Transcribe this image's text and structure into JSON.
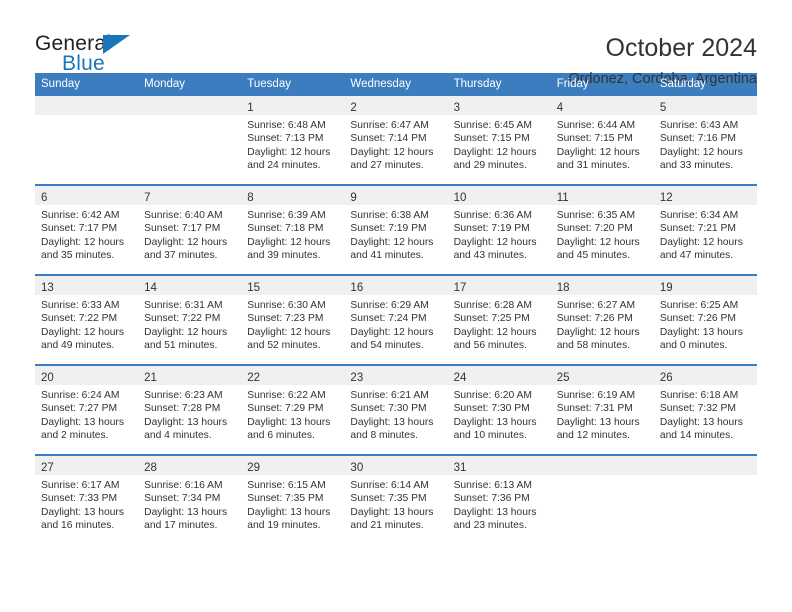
{
  "brand": {
    "name_top": "General",
    "name_bottom": "Blue",
    "accent": "#1b75bb"
  },
  "header": {
    "title": "October 2024",
    "location": "Ordonez, Cordoba, Argentina"
  },
  "theme": {
    "header_blue": "#3b7dbf",
    "daynum_band": "#f0f0f0",
    "text": "#333333"
  },
  "weekdays": [
    "Sunday",
    "Monday",
    "Tuesday",
    "Wednesday",
    "Thursday",
    "Friday",
    "Saturday"
  ],
  "labels": {
    "sunrise": "Sunrise:",
    "sunset": "Sunset:",
    "daylight": "Daylight:"
  },
  "weeks": [
    [
      {
        "day": ""
      },
      {
        "day": ""
      },
      {
        "day": "1",
        "sunrise": "Sunrise: 6:48 AM",
        "sunset": "Sunset: 7:13 PM",
        "daylight1": "Daylight: 12 hours",
        "daylight2": "and 24 minutes."
      },
      {
        "day": "2",
        "sunrise": "Sunrise: 6:47 AM",
        "sunset": "Sunset: 7:14 PM",
        "daylight1": "Daylight: 12 hours",
        "daylight2": "and 27 minutes."
      },
      {
        "day": "3",
        "sunrise": "Sunrise: 6:45 AM",
        "sunset": "Sunset: 7:15 PM",
        "daylight1": "Daylight: 12 hours",
        "daylight2": "and 29 minutes."
      },
      {
        "day": "4",
        "sunrise": "Sunrise: 6:44 AM",
        "sunset": "Sunset: 7:15 PM",
        "daylight1": "Daylight: 12 hours",
        "daylight2": "and 31 minutes."
      },
      {
        "day": "5",
        "sunrise": "Sunrise: 6:43 AM",
        "sunset": "Sunset: 7:16 PM",
        "daylight1": "Daylight: 12 hours",
        "daylight2": "and 33 minutes."
      }
    ],
    [
      {
        "day": "6",
        "sunrise": "Sunrise: 6:42 AM",
        "sunset": "Sunset: 7:17 PM",
        "daylight1": "Daylight: 12 hours",
        "daylight2": "and 35 minutes."
      },
      {
        "day": "7",
        "sunrise": "Sunrise: 6:40 AM",
        "sunset": "Sunset: 7:17 PM",
        "daylight1": "Daylight: 12 hours",
        "daylight2": "and 37 minutes."
      },
      {
        "day": "8",
        "sunrise": "Sunrise: 6:39 AM",
        "sunset": "Sunset: 7:18 PM",
        "daylight1": "Daylight: 12 hours",
        "daylight2": "and 39 minutes."
      },
      {
        "day": "9",
        "sunrise": "Sunrise: 6:38 AM",
        "sunset": "Sunset: 7:19 PM",
        "daylight1": "Daylight: 12 hours",
        "daylight2": "and 41 minutes."
      },
      {
        "day": "10",
        "sunrise": "Sunrise: 6:36 AM",
        "sunset": "Sunset: 7:19 PM",
        "daylight1": "Daylight: 12 hours",
        "daylight2": "and 43 minutes."
      },
      {
        "day": "11",
        "sunrise": "Sunrise: 6:35 AM",
        "sunset": "Sunset: 7:20 PM",
        "daylight1": "Daylight: 12 hours",
        "daylight2": "and 45 minutes."
      },
      {
        "day": "12",
        "sunrise": "Sunrise: 6:34 AM",
        "sunset": "Sunset: 7:21 PM",
        "daylight1": "Daylight: 12 hours",
        "daylight2": "and 47 minutes."
      }
    ],
    [
      {
        "day": "13",
        "sunrise": "Sunrise: 6:33 AM",
        "sunset": "Sunset: 7:22 PM",
        "daylight1": "Daylight: 12 hours",
        "daylight2": "and 49 minutes."
      },
      {
        "day": "14",
        "sunrise": "Sunrise: 6:31 AM",
        "sunset": "Sunset: 7:22 PM",
        "daylight1": "Daylight: 12 hours",
        "daylight2": "and 51 minutes."
      },
      {
        "day": "15",
        "sunrise": "Sunrise: 6:30 AM",
        "sunset": "Sunset: 7:23 PM",
        "daylight1": "Daylight: 12 hours",
        "daylight2": "and 52 minutes."
      },
      {
        "day": "16",
        "sunrise": "Sunrise: 6:29 AM",
        "sunset": "Sunset: 7:24 PM",
        "daylight1": "Daylight: 12 hours",
        "daylight2": "and 54 minutes."
      },
      {
        "day": "17",
        "sunrise": "Sunrise: 6:28 AM",
        "sunset": "Sunset: 7:25 PM",
        "daylight1": "Daylight: 12 hours",
        "daylight2": "and 56 minutes."
      },
      {
        "day": "18",
        "sunrise": "Sunrise: 6:27 AM",
        "sunset": "Sunset: 7:26 PM",
        "daylight1": "Daylight: 12 hours",
        "daylight2": "and 58 minutes."
      },
      {
        "day": "19",
        "sunrise": "Sunrise: 6:25 AM",
        "sunset": "Sunset: 7:26 PM",
        "daylight1": "Daylight: 13 hours",
        "daylight2": "and 0 minutes."
      }
    ],
    [
      {
        "day": "20",
        "sunrise": "Sunrise: 6:24 AM",
        "sunset": "Sunset: 7:27 PM",
        "daylight1": "Daylight: 13 hours",
        "daylight2": "and 2 minutes."
      },
      {
        "day": "21",
        "sunrise": "Sunrise: 6:23 AM",
        "sunset": "Sunset: 7:28 PM",
        "daylight1": "Daylight: 13 hours",
        "daylight2": "and 4 minutes."
      },
      {
        "day": "22",
        "sunrise": "Sunrise: 6:22 AM",
        "sunset": "Sunset: 7:29 PM",
        "daylight1": "Daylight: 13 hours",
        "daylight2": "and 6 minutes."
      },
      {
        "day": "23",
        "sunrise": "Sunrise: 6:21 AM",
        "sunset": "Sunset: 7:30 PM",
        "daylight1": "Daylight: 13 hours",
        "daylight2": "and 8 minutes."
      },
      {
        "day": "24",
        "sunrise": "Sunrise: 6:20 AM",
        "sunset": "Sunset: 7:30 PM",
        "daylight1": "Daylight: 13 hours",
        "daylight2": "and 10 minutes."
      },
      {
        "day": "25",
        "sunrise": "Sunrise: 6:19 AM",
        "sunset": "Sunset: 7:31 PM",
        "daylight1": "Daylight: 13 hours",
        "daylight2": "and 12 minutes."
      },
      {
        "day": "26",
        "sunrise": "Sunrise: 6:18 AM",
        "sunset": "Sunset: 7:32 PM",
        "daylight1": "Daylight: 13 hours",
        "daylight2": "and 14 minutes."
      }
    ],
    [
      {
        "day": "27",
        "sunrise": "Sunrise: 6:17 AM",
        "sunset": "Sunset: 7:33 PM",
        "daylight1": "Daylight: 13 hours",
        "daylight2": "and 16 minutes."
      },
      {
        "day": "28",
        "sunrise": "Sunrise: 6:16 AM",
        "sunset": "Sunset: 7:34 PM",
        "daylight1": "Daylight: 13 hours",
        "daylight2": "and 17 minutes."
      },
      {
        "day": "29",
        "sunrise": "Sunrise: 6:15 AM",
        "sunset": "Sunset: 7:35 PM",
        "daylight1": "Daylight: 13 hours",
        "daylight2": "and 19 minutes."
      },
      {
        "day": "30",
        "sunrise": "Sunrise: 6:14 AM",
        "sunset": "Sunset: 7:35 PM",
        "daylight1": "Daylight: 13 hours",
        "daylight2": "and 21 minutes."
      },
      {
        "day": "31",
        "sunrise": "Sunrise: 6:13 AM",
        "sunset": "Sunset: 7:36 PM",
        "daylight1": "Daylight: 13 hours",
        "daylight2": "and 23 minutes."
      },
      {
        "day": ""
      },
      {
        "day": ""
      }
    ]
  ]
}
